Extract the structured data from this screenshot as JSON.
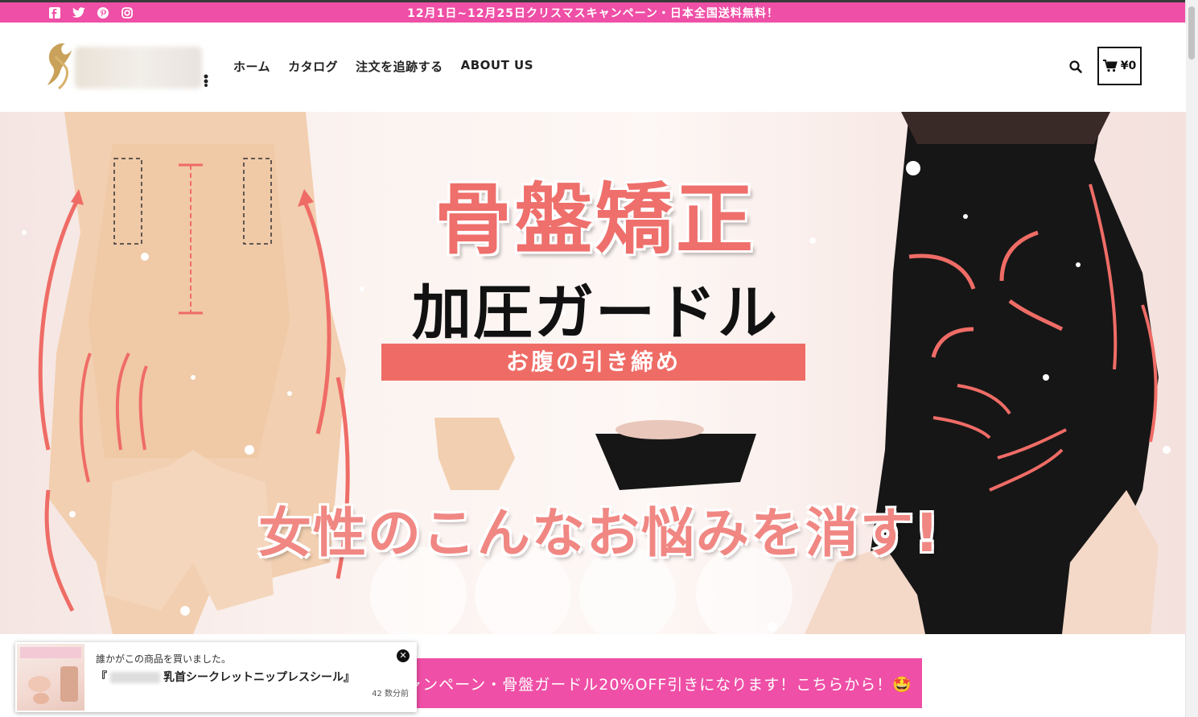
{
  "announcement": "12月1日~12月25日クリスマスキャンペーン・日本全国送料無料！",
  "social": [
    {
      "name": "facebook-icon"
    },
    {
      "name": "twitter-icon"
    },
    {
      "name": "pinterest-icon"
    },
    {
      "name": "instagram-icon"
    }
  ],
  "nav": {
    "home": "ホーム",
    "catalog": "カタログ",
    "track": "注文を追跡する",
    "about": "ABOUT US"
  },
  "cart": {
    "total": "¥0"
  },
  "hero": {
    "title": "骨盤矯正",
    "subtitle": "加圧ガードル",
    "band": "お腹の引き締め",
    "tagline": "女性のこんなお悩みを消す!"
  },
  "promo": "🎄CHRISTMASキャンペーン・骨盤ガードル20%OFF引きになります！こちらから！🤩",
  "popup": {
    "line1": "誰かがこの商品を買いました。",
    "product_prefix": "『",
    "product": "乳首シークレットニップレスシール』",
    "time": "42 数分前"
  },
  "colors": {
    "accent": "#ef4fa6",
    "coral": "#ef6c66"
  }
}
